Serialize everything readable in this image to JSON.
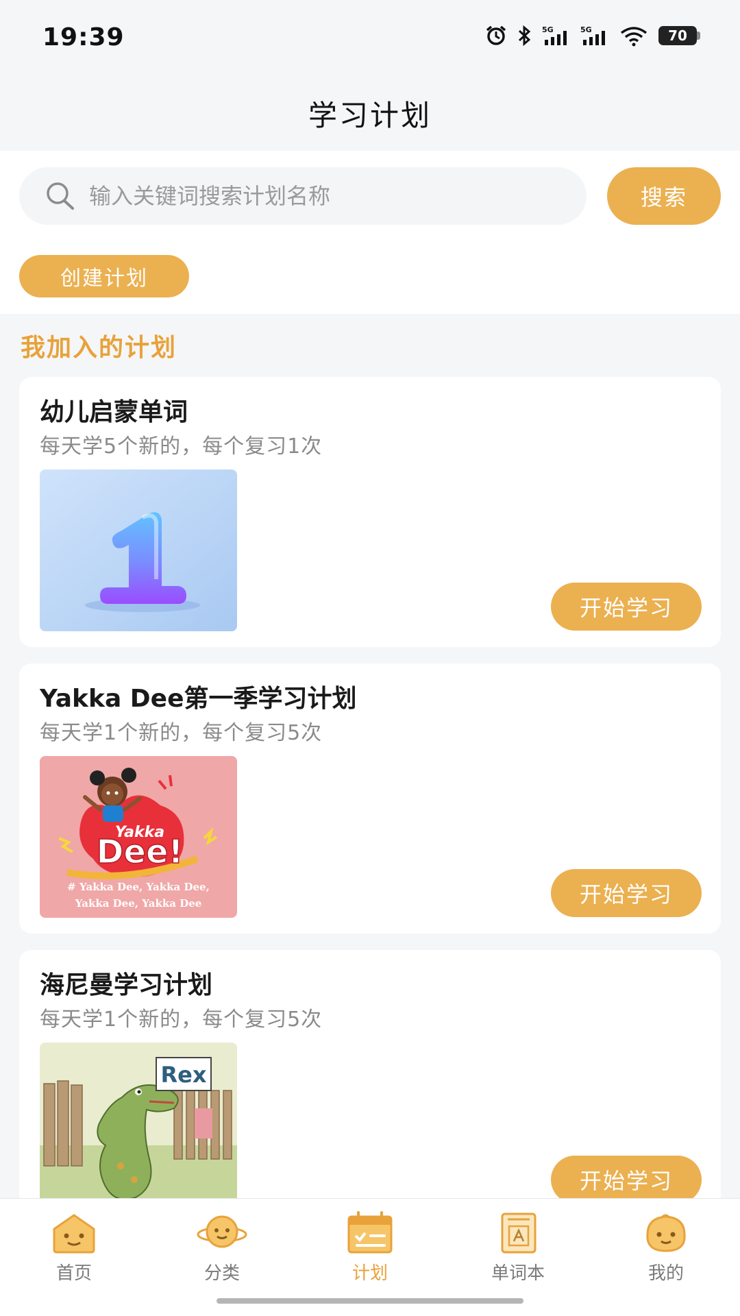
{
  "status_bar": {
    "time": "19:39",
    "battery": "70",
    "signal_1": "5G",
    "signal_2": "5G"
  },
  "header": {
    "title": "学习计划"
  },
  "search": {
    "placeholder": "输入关键词搜索计划名称",
    "button_label": "搜索"
  },
  "create_button_label": "创建计划",
  "section_title": "我加入的计划",
  "plans": [
    {
      "title": "幼儿启蒙单词",
      "subtitle": "每天学5个新的，每个复习1次",
      "button_label": "开始学习"
    },
    {
      "title": "Yakka Dee第一季学习计划",
      "subtitle": "每天学1个新的，每个复习5次",
      "button_label": "开始学习",
      "cover_logo_text": "Dee!",
      "cover_logo_small": "Yakka",
      "cover_caption_1": "# Yakka Dee, Yakka Dee,",
      "cover_caption_2": "Yakka Dee, Yakka Dee"
    },
    {
      "title": "海尼曼学习计划",
      "subtitle": "每天学1个新的，每个复习5次",
      "button_label": "开始学习",
      "cover_sign_text": "Rex"
    }
  ],
  "tabbar": {
    "items": [
      {
        "label": "首页",
        "icon": "home-face-icon",
        "active": false
      },
      {
        "label": "分类",
        "icon": "planet-face-icon",
        "active": false
      },
      {
        "label": "计划",
        "icon": "calendar-list-icon",
        "active": true
      },
      {
        "label": "单词本",
        "icon": "word-book-icon",
        "active": false
      },
      {
        "label": "我的",
        "icon": "baby-face-icon",
        "active": false
      }
    ]
  },
  "colors": {
    "accent": "#ebb050",
    "section_title": "#e8a23a",
    "background": "#f5f6f7"
  }
}
